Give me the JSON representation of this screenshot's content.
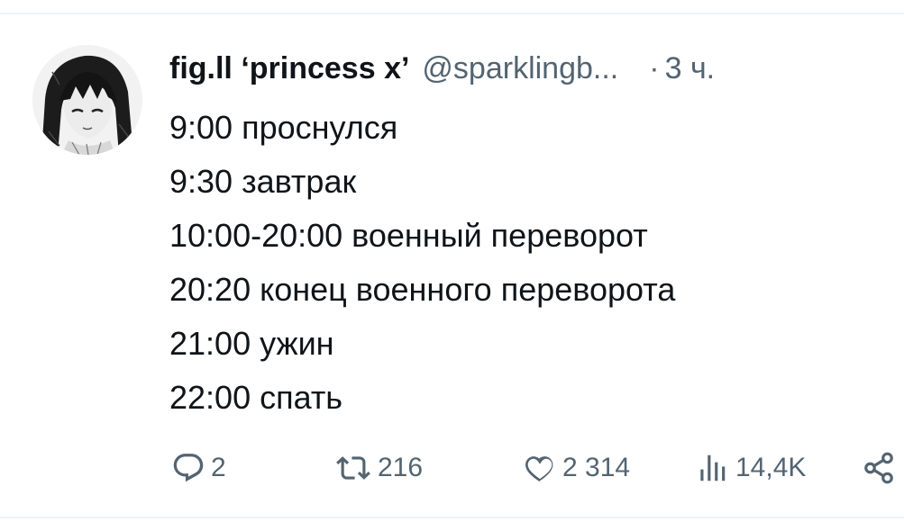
{
  "tweet": {
    "display_name": "fig.ll ‘princess x’",
    "handle": "@sparklingb...",
    "separator": "·",
    "time": "3 ч.",
    "lines": [
      "9:00 проснулся",
      "9:30 завтрак",
      "10:00-20:00 военный переворот",
      "20:20 конец военного переворота",
      "21:00 ужин",
      "22:00 спать"
    ],
    "actions": {
      "reply_count": "2",
      "retweet_count": "216",
      "like_count": "2 314",
      "views_count": "14,4K"
    }
  },
  "icons": {
    "reply": "comment-bubble-icon",
    "retweet": "retweet-icon",
    "like": "heart-icon",
    "views": "bar-chart-views-icon",
    "share": "share-icon"
  },
  "colors": {
    "text_primary": "#0f1419",
    "text_secondary": "#536471",
    "divider": "#eff3f4",
    "background": "#ffffff"
  }
}
